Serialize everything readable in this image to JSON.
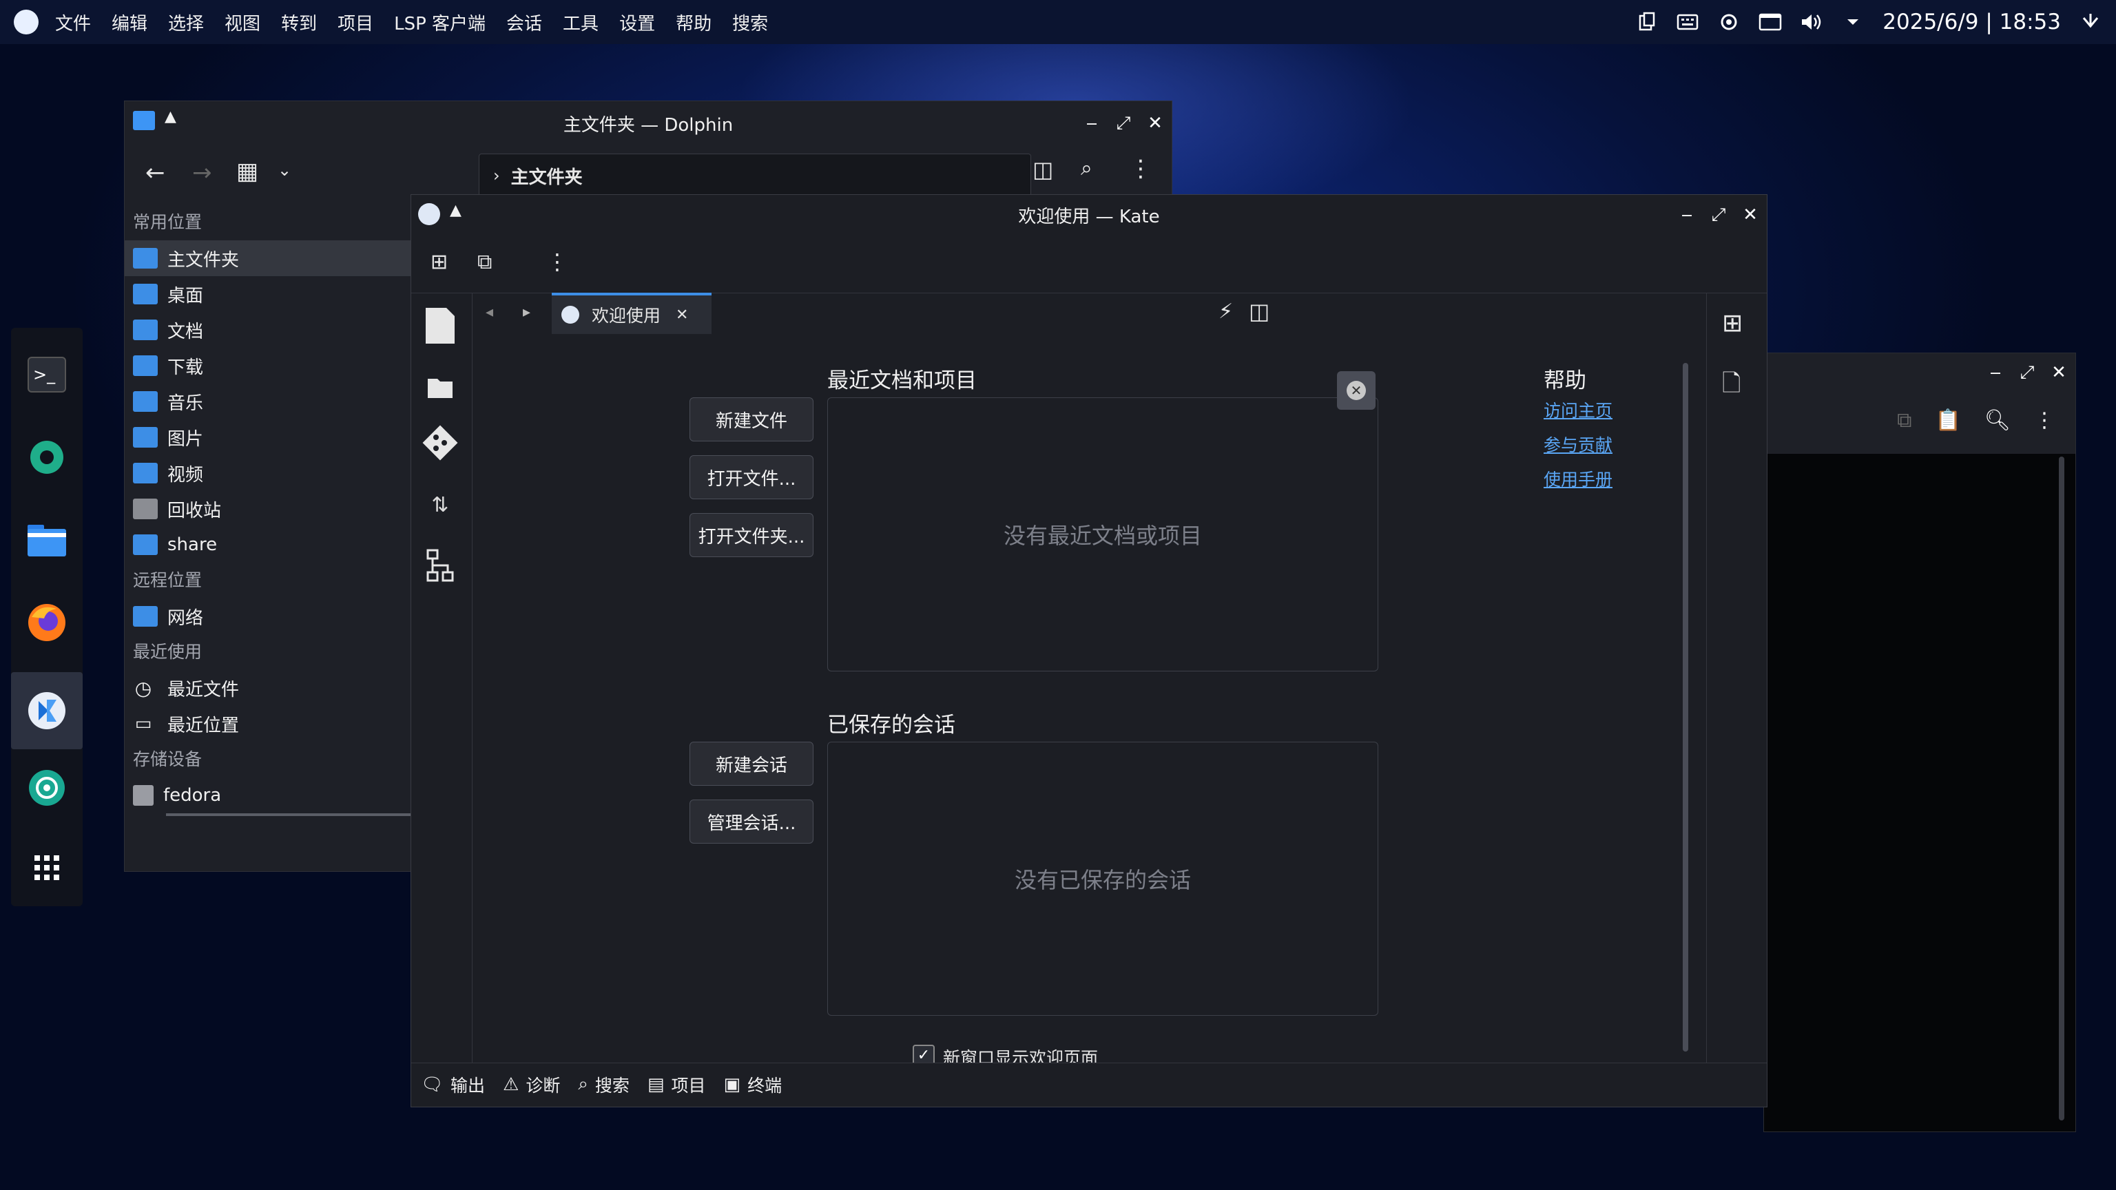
{
  "topbar": {
    "menu": [
      "文件",
      "编辑",
      "选择",
      "视图",
      "转到",
      "项目",
      "LSP 客户端",
      "会话",
      "工具",
      "设置",
      "帮助",
      "搜索"
    ],
    "datetime": "2025/6/9 | 18:53",
    "icons": [
      "clipboard-icon",
      "keyboard-icon",
      "brightness-icon",
      "display-icon",
      "volume-icon",
      "chevron-down-icon",
      "power-icon"
    ]
  },
  "dock": [
    "terminal-icon",
    "settings-icon",
    "folder-icon",
    "firefox-icon",
    "kate-icon",
    "camera-icon",
    "app-grid-icon"
  ],
  "dolphin": {
    "title": "主文件夹 — Dolphin",
    "path": "主文件夹",
    "sections": {
      "places": "常用位置",
      "remote": "远程位置",
      "recent": "最近使用",
      "devices": "存储设备"
    },
    "places": [
      "主文件夹",
      "桌面",
      "文档",
      "下载",
      "音乐",
      "图片",
      "视频",
      "回收站",
      "share"
    ],
    "remote": [
      "网络"
    ],
    "recent": [
      "最近文件",
      "最近位置"
    ],
    "devices": [
      "fedora"
    ]
  },
  "kate": {
    "title": "欢迎使用 — Kate",
    "tab_label": "欢迎使用",
    "recent_heading": "最近文档和项目",
    "recent_empty": "没有最近文档或项目",
    "sessions_heading": "已保存的会话",
    "sessions_empty": "没有已保存的会话",
    "help_heading": "帮助",
    "help_links": [
      "访问主页",
      "参与贡献",
      "使用手册"
    ],
    "buttons": {
      "new_file": "新建文件",
      "open_file": "打开文件...",
      "open_folder": "打开文件夹...",
      "new_session": "新建会话",
      "manage_sessions": "管理会话..."
    },
    "show_welcome_checkbox": "新窗口显示欢迎页面",
    "bottom_tabs": [
      "输出",
      "诊断",
      "搜索",
      "项目",
      "终端"
    ]
  }
}
